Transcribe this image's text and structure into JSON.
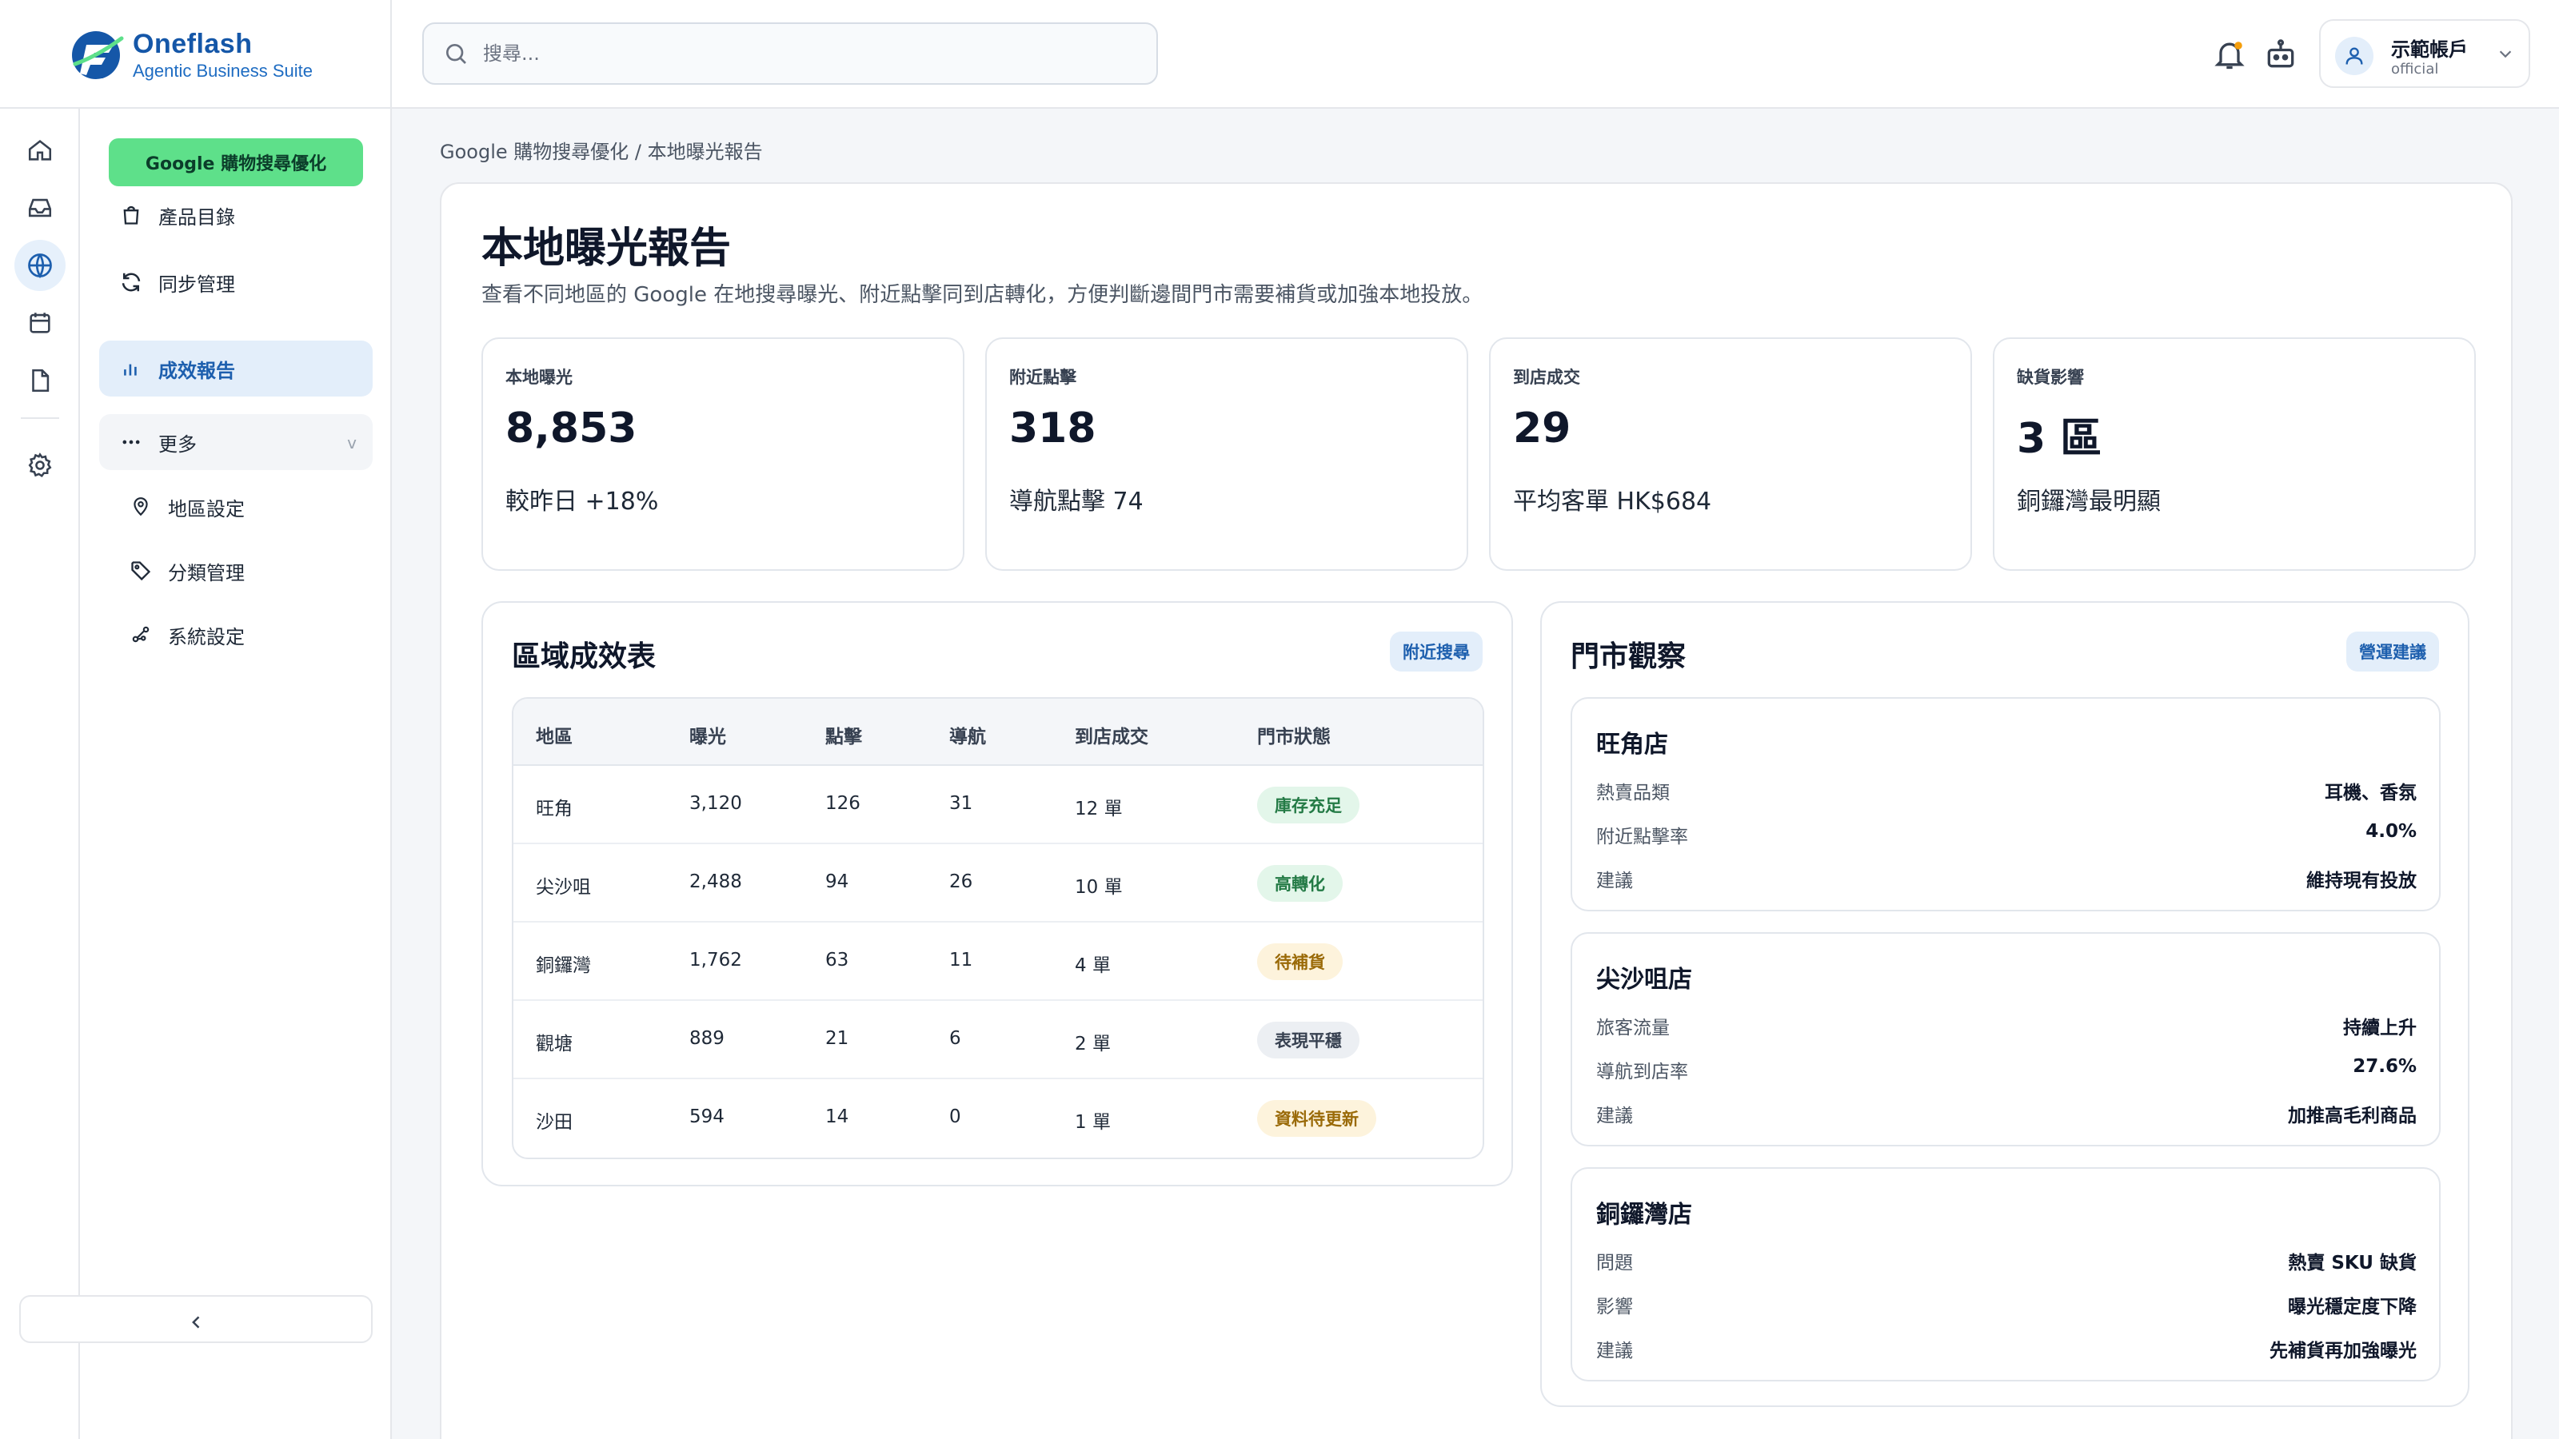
{
  "brand": {
    "name": "Oneflash",
    "tagline": "Agentic Business Suite"
  },
  "search": {
    "placeholder": "搜尋..."
  },
  "account": {
    "name": "示範帳戶",
    "role": "official"
  },
  "sidebar": {
    "badge": "Google 購物搜尋優化",
    "items": [
      {
        "label": "產品目錄",
        "icon": "bag-icon"
      },
      {
        "label": "同步管理",
        "icon": "sync-icon"
      },
      {
        "label": "成效報告",
        "icon": "bar-chart-icon",
        "active": true
      },
      {
        "label": "更多",
        "icon": "more-icon"
      }
    ],
    "sub_items": [
      {
        "label": "地區設定",
        "icon": "location-pin-icon"
      },
      {
        "label": "分類管理",
        "icon": "tag-icon"
      },
      {
        "label": "系統設定",
        "icon": "share-icon"
      }
    ]
  },
  "breadcrumb": "Google 購物搜尋優化 / 本地曝光報告",
  "page": {
    "title": "本地曝光報告",
    "description": "查看不同地區的 Google 在地搜尋曝光、附近點擊同到店轉化，方便判斷邊間門市需要補貨或加強本地投放。"
  },
  "kpis": [
    {
      "label": "本地曝光",
      "value": "8,853",
      "sub": "較昨日 +18%"
    },
    {
      "label": "附近點擊",
      "value": "318",
      "sub": "導航點擊 74"
    },
    {
      "label": "到店成交",
      "value": "29",
      "sub": "平均客單 HK$684"
    },
    {
      "label": "缺貨影響",
      "value": "3 區",
      "sub": "銅鑼灣最明顯"
    }
  ],
  "region_table": {
    "title": "區域成效表",
    "tag": "附近搜尋",
    "headers": [
      "地區",
      "曝光",
      "點擊",
      "導航",
      "到店成交",
      "門市狀態"
    ],
    "rows": [
      {
        "region": "旺角",
        "impressions": "3,120",
        "clicks": "126",
        "navigation": "31",
        "orders": "12 單",
        "status": "庫存充足",
        "status_color": "#e3f6ea",
        "status_text_color": "#237a45"
      },
      {
        "region": "尖沙咀",
        "impressions": "2,488",
        "clicks": "94",
        "navigation": "26",
        "orders": "10 單",
        "status": "高轉化",
        "status_color": "#e3f6ea",
        "status_text_color": "#237a45"
      },
      {
        "region": "銅鑼灣",
        "impressions": "1,762",
        "clicks": "63",
        "navigation": "11",
        "orders": "4 單",
        "status": "待補貨",
        "status_color": "#fdf3dc",
        "status_text_color": "#9a6a08"
      },
      {
        "region": "觀塘",
        "impressions": "889",
        "clicks": "21",
        "navigation": "6",
        "orders": "2 單",
        "status": "表現平穩",
        "status_color": "#eceff3",
        "status_text_color": "#374151"
      },
      {
        "region": "沙田",
        "impressions": "594",
        "clicks": "14",
        "navigation": "0",
        "orders": "1 單",
        "status": "資料待更新",
        "status_color": "#fdf3dc",
        "status_text_color": "#9a6a08"
      }
    ]
  },
  "store_panel": {
    "title": "門市觀察",
    "tag": "營運建議",
    "stores": [
      {
        "name": "旺角店",
        "rows": [
          {
            "k": "熱賣品類",
            "v": "耳機、香氛"
          },
          {
            "k": "附近點擊率",
            "v": "4.0%"
          },
          {
            "k": "建議",
            "v": "維持現有投放"
          }
        ]
      },
      {
        "name": "尖沙咀店",
        "rows": [
          {
            "k": "旅客流量",
            "v": "持續上升"
          },
          {
            "k": "導航到店率",
            "v": "27.6%"
          },
          {
            "k": "建議",
            "v": "加推高毛利商品"
          }
        ]
      },
      {
        "name": "銅鑼灣店",
        "rows": [
          {
            "k": "問題",
            "v": "熱賣 SKU 缺貨"
          },
          {
            "k": "影響",
            "v": "曝光穩定度下降"
          },
          {
            "k": "建議",
            "v": "先補貨再加強曝光"
          }
        ]
      }
    ]
  },
  "colors": {
    "accent": "#1d5fae",
    "brand_green": "#5ee08a",
    "active_bg": "#e3eefa"
  }
}
